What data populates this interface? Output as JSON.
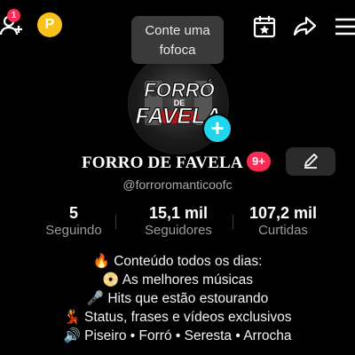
{
  "top_bar": {
    "add_user_icon": "person-plus-icon",
    "notification_count": "1",
    "coin_label": "P",
    "calendar_icon": "calendar-star-icon",
    "share_icon": "share-arrow-icon",
    "menu_icon": "hamburger-menu-icon"
  },
  "tooltip": {
    "text": "Conte uma fofoca"
  },
  "profile": {
    "avatar_logo_line1": "FORRÓ",
    "avatar_logo_line2": "DE",
    "avatar_logo_line3": "FAVELA",
    "name": "FORRO DE FAVELA",
    "name_badge": "9+",
    "handle": "@forroromanticoofc"
  },
  "stats": [
    {
      "value": "5",
      "label": "Seguindo"
    },
    {
      "value": "15,1 mil",
      "label": "Seguidores"
    },
    {
      "value": "107,2 mil",
      "label": "Curtidas"
    }
  ],
  "bio": [
    "🔥 Conteúdo todos os dias:",
    "📀 As melhores músicas",
    "🎤 Hits que estão estourando",
    "💃 Status, frases e vídeos exclusivos",
    "🔊 Piseiro • Forró • Seresta • Arrocha"
  ],
  "colors": {
    "background": "#000000",
    "accent_red": "#fe2c55",
    "accent_cyan": "#20d5ec",
    "coin_yellow": "#f8c11c",
    "muted_text": "#9a9a9a"
  }
}
